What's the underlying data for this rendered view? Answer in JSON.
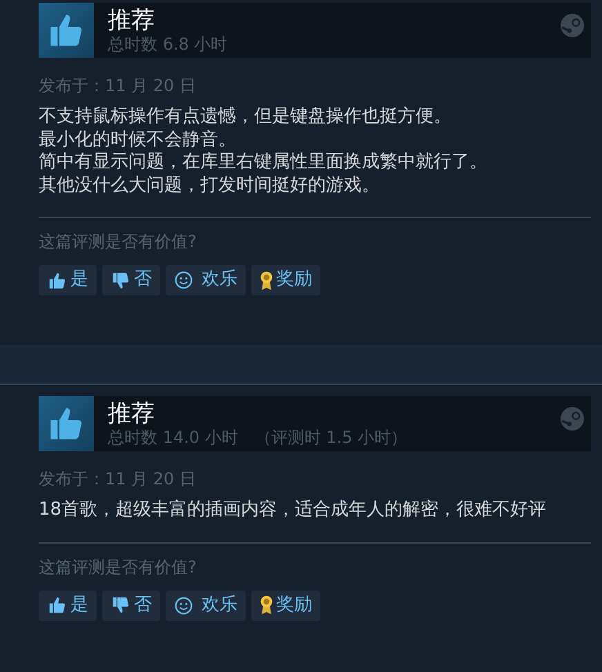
{
  "reviews": [
    {
      "verdict": "推荐",
      "hours": "总时数 6.8 小时",
      "posted": "发布于：11 月 20 日",
      "lines": [
        "不支持鼠标操作有点遗憾，但是键盘操作也挺方便。",
        "最小化的时候不会静音。",
        "简中有显示问题，在库里右键属性里面换成繁中就行了。",
        "其他没什么大问题，打发时间挺好的游戏。"
      ],
      "question": "这篇评测是否有价值?",
      "buttons": [
        {
          "kind": "yes",
          "label": "是"
        },
        {
          "kind": "no",
          "label": "否"
        },
        {
          "kind": "funny",
          "label": "欢乐"
        },
        {
          "kind": "award",
          "label": "奖励"
        }
      ]
    },
    {
      "verdict": "推荐",
      "hours": "总时数 14.0 小时",
      "hours_at_review": "（评测时 1.5 小时）",
      "posted": "发布于：11 月 20 日",
      "lines": [
        "18首歌，超级丰富的插画内容，适合成年人的解密，很难不好评"
      ],
      "question": "这篇评测是否有价值?",
      "buttons": [
        {
          "kind": "yes",
          "label": "是"
        },
        {
          "kind": "no",
          "label": "否"
        },
        {
          "kind": "funny",
          "label": "欢乐"
        },
        {
          "kind": "award",
          "label": "奖励"
        }
      ]
    }
  ]
}
